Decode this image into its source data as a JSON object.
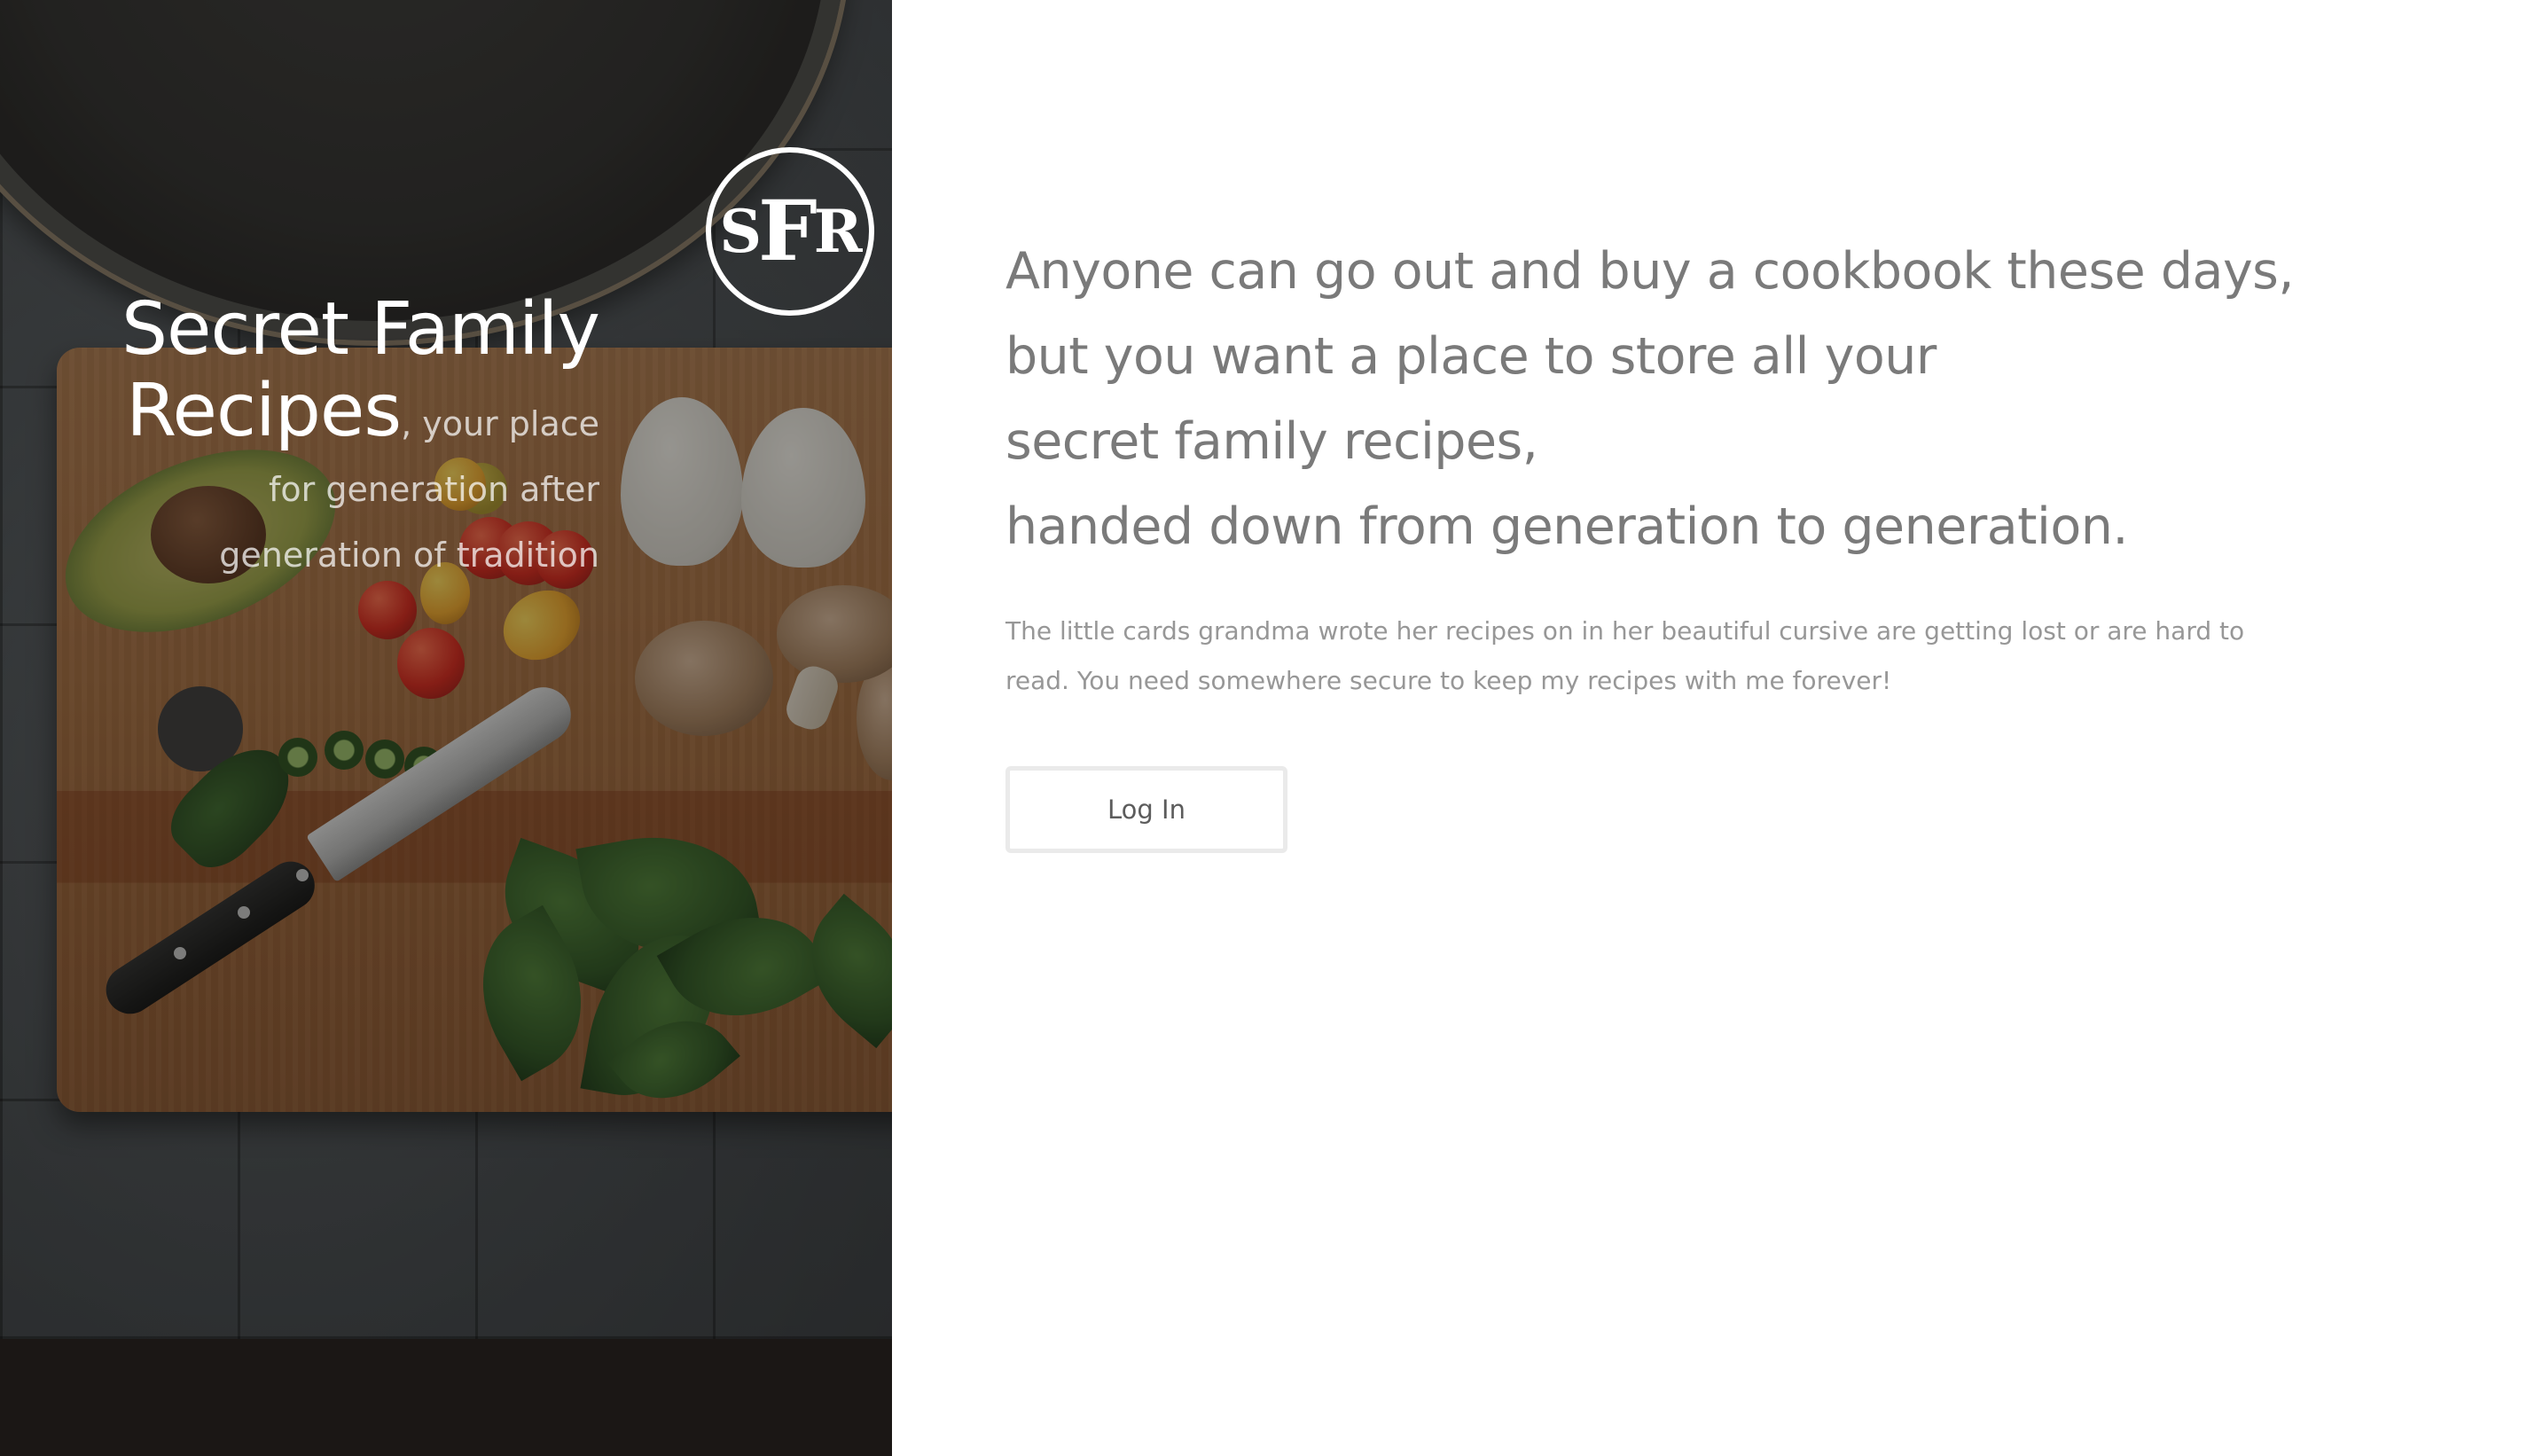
{
  "brand": {
    "logo_text": "SFR",
    "logo_letters": [
      "S",
      "F",
      "R"
    ],
    "title": "Secret Family Recipes",
    "tagline": ", your place for generation after generation of tradition"
  },
  "main": {
    "headline_lines": [
      "Anyone can go out and buy a cookbook these days,",
      "but you want a place to store all your",
      "secret family recipes,",
      "handed down from generation to generation."
    ],
    "intro": "The little cards grandma wrote her recipes on in her beautiful cursive are getting lost or are hard to read. You need somewhere secure to keep my recipes with me forever!",
    "login_label": "Log In"
  },
  "colors": {
    "page_background": "#ffffff",
    "headline_text": "#7a7a7a",
    "body_text": "#979797",
    "button_border": "#eaeaea",
    "hero_bottom_bar": "#1b1715",
    "hero_text": "#ffffff"
  },
  "images": {
    "hero_photo": "kitchen-cutting-board-with-vegetables-photo"
  }
}
